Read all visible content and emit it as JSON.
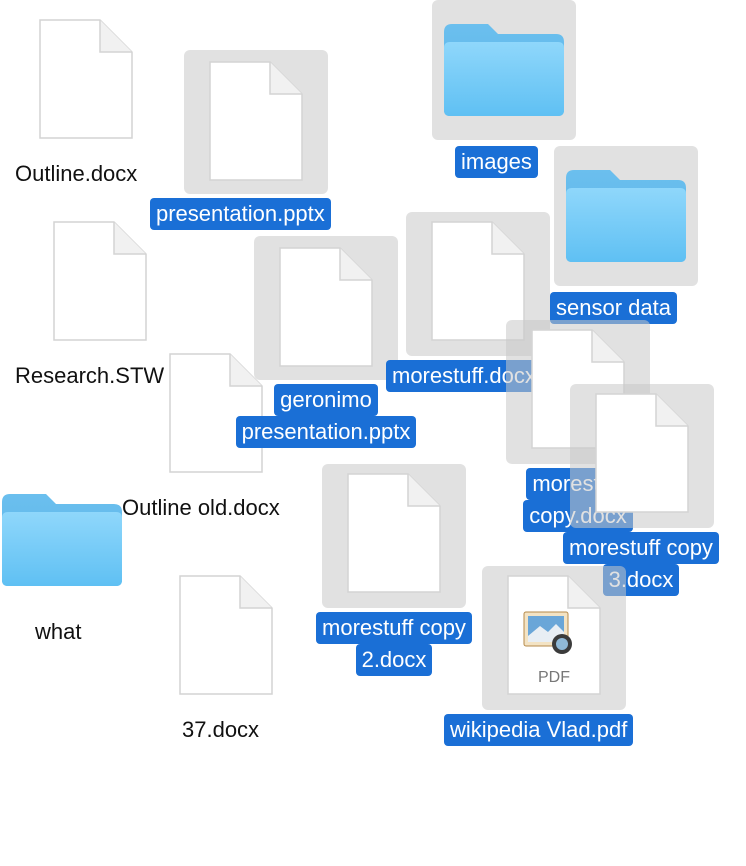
{
  "files": {
    "outline_docx": "Outline.docx",
    "presentation_pptx": "presentation.pptx",
    "images": "images",
    "sensor_data": "sensor data",
    "research_stw": "Research.STW",
    "morestuff_docx": "morestuff.docx",
    "geronimo_line1": "geronimo",
    "geronimo_line2": "presentation.pptx",
    "outline_old_docx": "Outline old.docx",
    "morestuff_copy_line1": "morestuff",
    "morestuff_copy_line2": "copy.docx",
    "morestuff_copy3_line1": "morestuff copy",
    "morestuff_copy3_line2": "3.docx",
    "what": "what",
    "morestuff_copy2_line1": "morestuff copy",
    "morestuff_copy2_line2": "2.docx",
    "doc_37": "37.docx",
    "wikipedia_pdf": "wikipedia Vlad.pdf"
  },
  "pdf_badge": "PDF",
  "colors": {
    "selection": "#1a6fd6",
    "folder": "#6ac8f6"
  }
}
